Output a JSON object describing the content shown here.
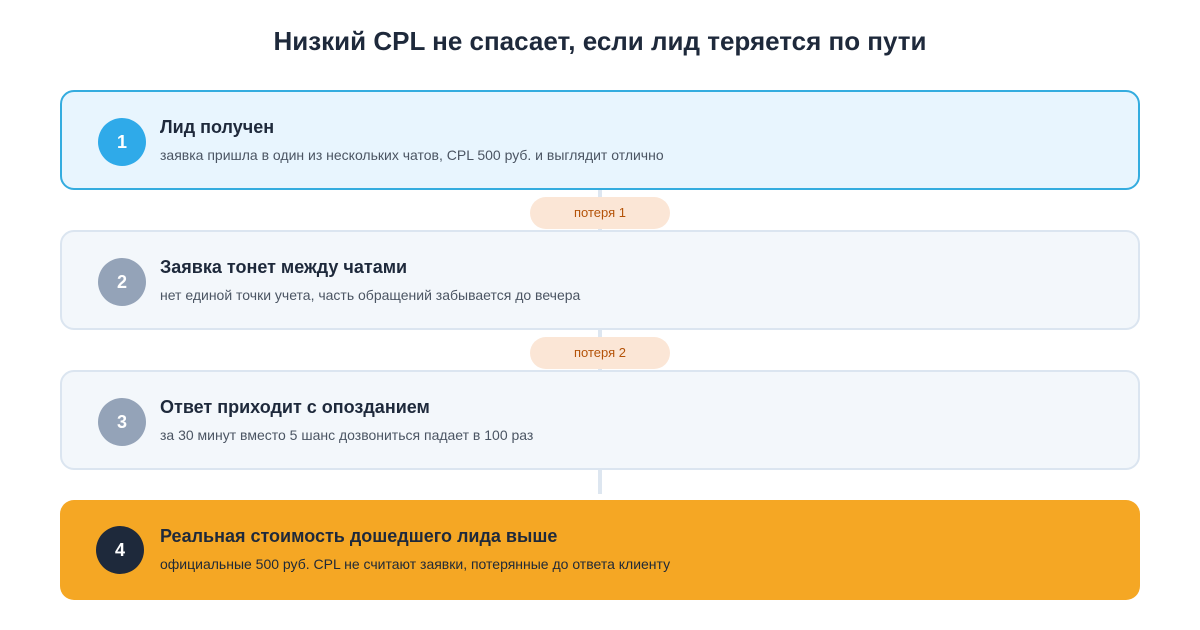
{
  "title": "Низкий CPL не спасает, если лид теряется по пути",
  "colors": {
    "step_active_bg": "#e8f5fe",
    "step_active_border": "#34acdf",
    "step_muted_bg": "#f3f7fb",
    "step_result_bg": "#f5a724",
    "loss_badge_bg": "#fbe6d6",
    "loss_badge_text": "#b45309"
  },
  "steps": [
    {
      "number": "1",
      "title": "Лид получен",
      "description": "заявка пришла в один из нескольких чатов, CPL 500 руб. и выглядит отлично"
    },
    {
      "number": "2",
      "title": "Заявка тонет между чатами",
      "description": "нет единой точки учета, часть обращений забывается до вечера"
    },
    {
      "number": "3",
      "title": "Ответ приходит с опозданием",
      "description": "за 30 минут вместо 5 шанс дозвониться падает в 100 раз"
    },
    {
      "number": "4",
      "title": "Реальная стоимость дошедшего лида выше",
      "description": "официальные 500 руб. CPL не считают заявки, потерянные до ответа клиенту"
    }
  ],
  "losses": [
    {
      "label": "потеря 1"
    },
    {
      "label": "потеря 2"
    }
  ]
}
